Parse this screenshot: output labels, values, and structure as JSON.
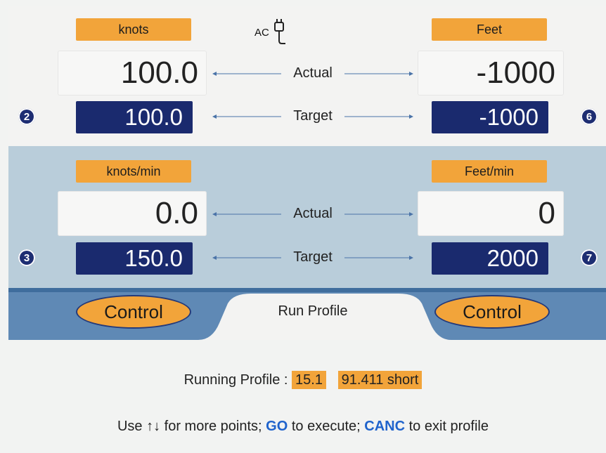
{
  "colors": {
    "accent_orange": "#f2a43a",
    "target_navy": "#1a2a6e",
    "mid_panel_blue": "#b9cdda",
    "keyword_blue": "#1f63cc"
  },
  "top_section": {
    "left_unit": "knots",
    "right_unit": "Feet",
    "power_label": "AC",
    "power_icon": "plug-icon",
    "actual_label": "Actual",
    "target_label": "Target",
    "left_actual": "100.0",
    "right_actual": "-1000",
    "left_target": "100.0",
    "right_target": "-1000",
    "left_badge": "2",
    "right_badge": "6"
  },
  "rate_section": {
    "left_unit": "knots/min",
    "right_unit": "Feet/min",
    "actual_label": "Actual",
    "target_label": "Target",
    "left_actual": "0.0",
    "right_actual": "0",
    "left_target": "150.0",
    "right_target": "2000",
    "left_badge": "3",
    "right_badge": "7"
  },
  "tabs": {
    "left_control": "Control",
    "center_tab": "Run Profile",
    "right_control": "Control"
  },
  "status": {
    "prefix": "Running Profile :",
    "profile_number": "15.1",
    "profile_detail": "91.411 short"
  },
  "help": {
    "part1": "Use ↑↓ for more points; ",
    "go": "GO",
    "part2": " to execute; ",
    "canc": "CANC",
    "part3": " to exit profile"
  }
}
